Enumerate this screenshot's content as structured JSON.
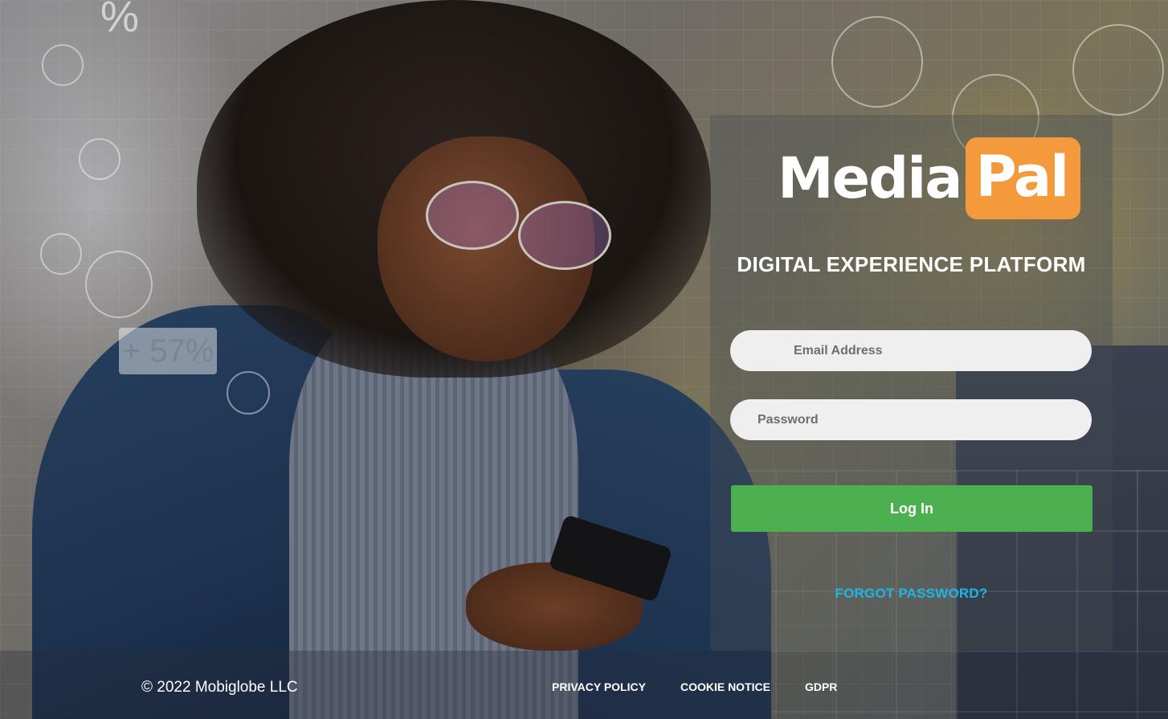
{
  "brand": {
    "logo_word_1": "Media",
    "logo_word_2": "Pal",
    "tagline": "DIGITAL EXPERIENCE PLATFORM",
    "accent_color": "#f59a3c"
  },
  "background": {
    "stat_text": "+ 57%",
    "percent_glyph": "%"
  },
  "login": {
    "email_placeholder": "Email Address",
    "email_value": "",
    "password_placeholder": "Password",
    "password_value": "",
    "submit_label": "Log In",
    "submit_color": "#4caf50",
    "forgot_label": "FORGOT PASSWORD?",
    "forgot_color": "#1eb4e6"
  },
  "footer": {
    "copyright": "© 2022 Mobiglobe LLC",
    "links": [
      {
        "label": "PRIVACY POLICY"
      },
      {
        "label": "COOKIE NOTICE"
      },
      {
        "label": "GDPR"
      }
    ]
  }
}
